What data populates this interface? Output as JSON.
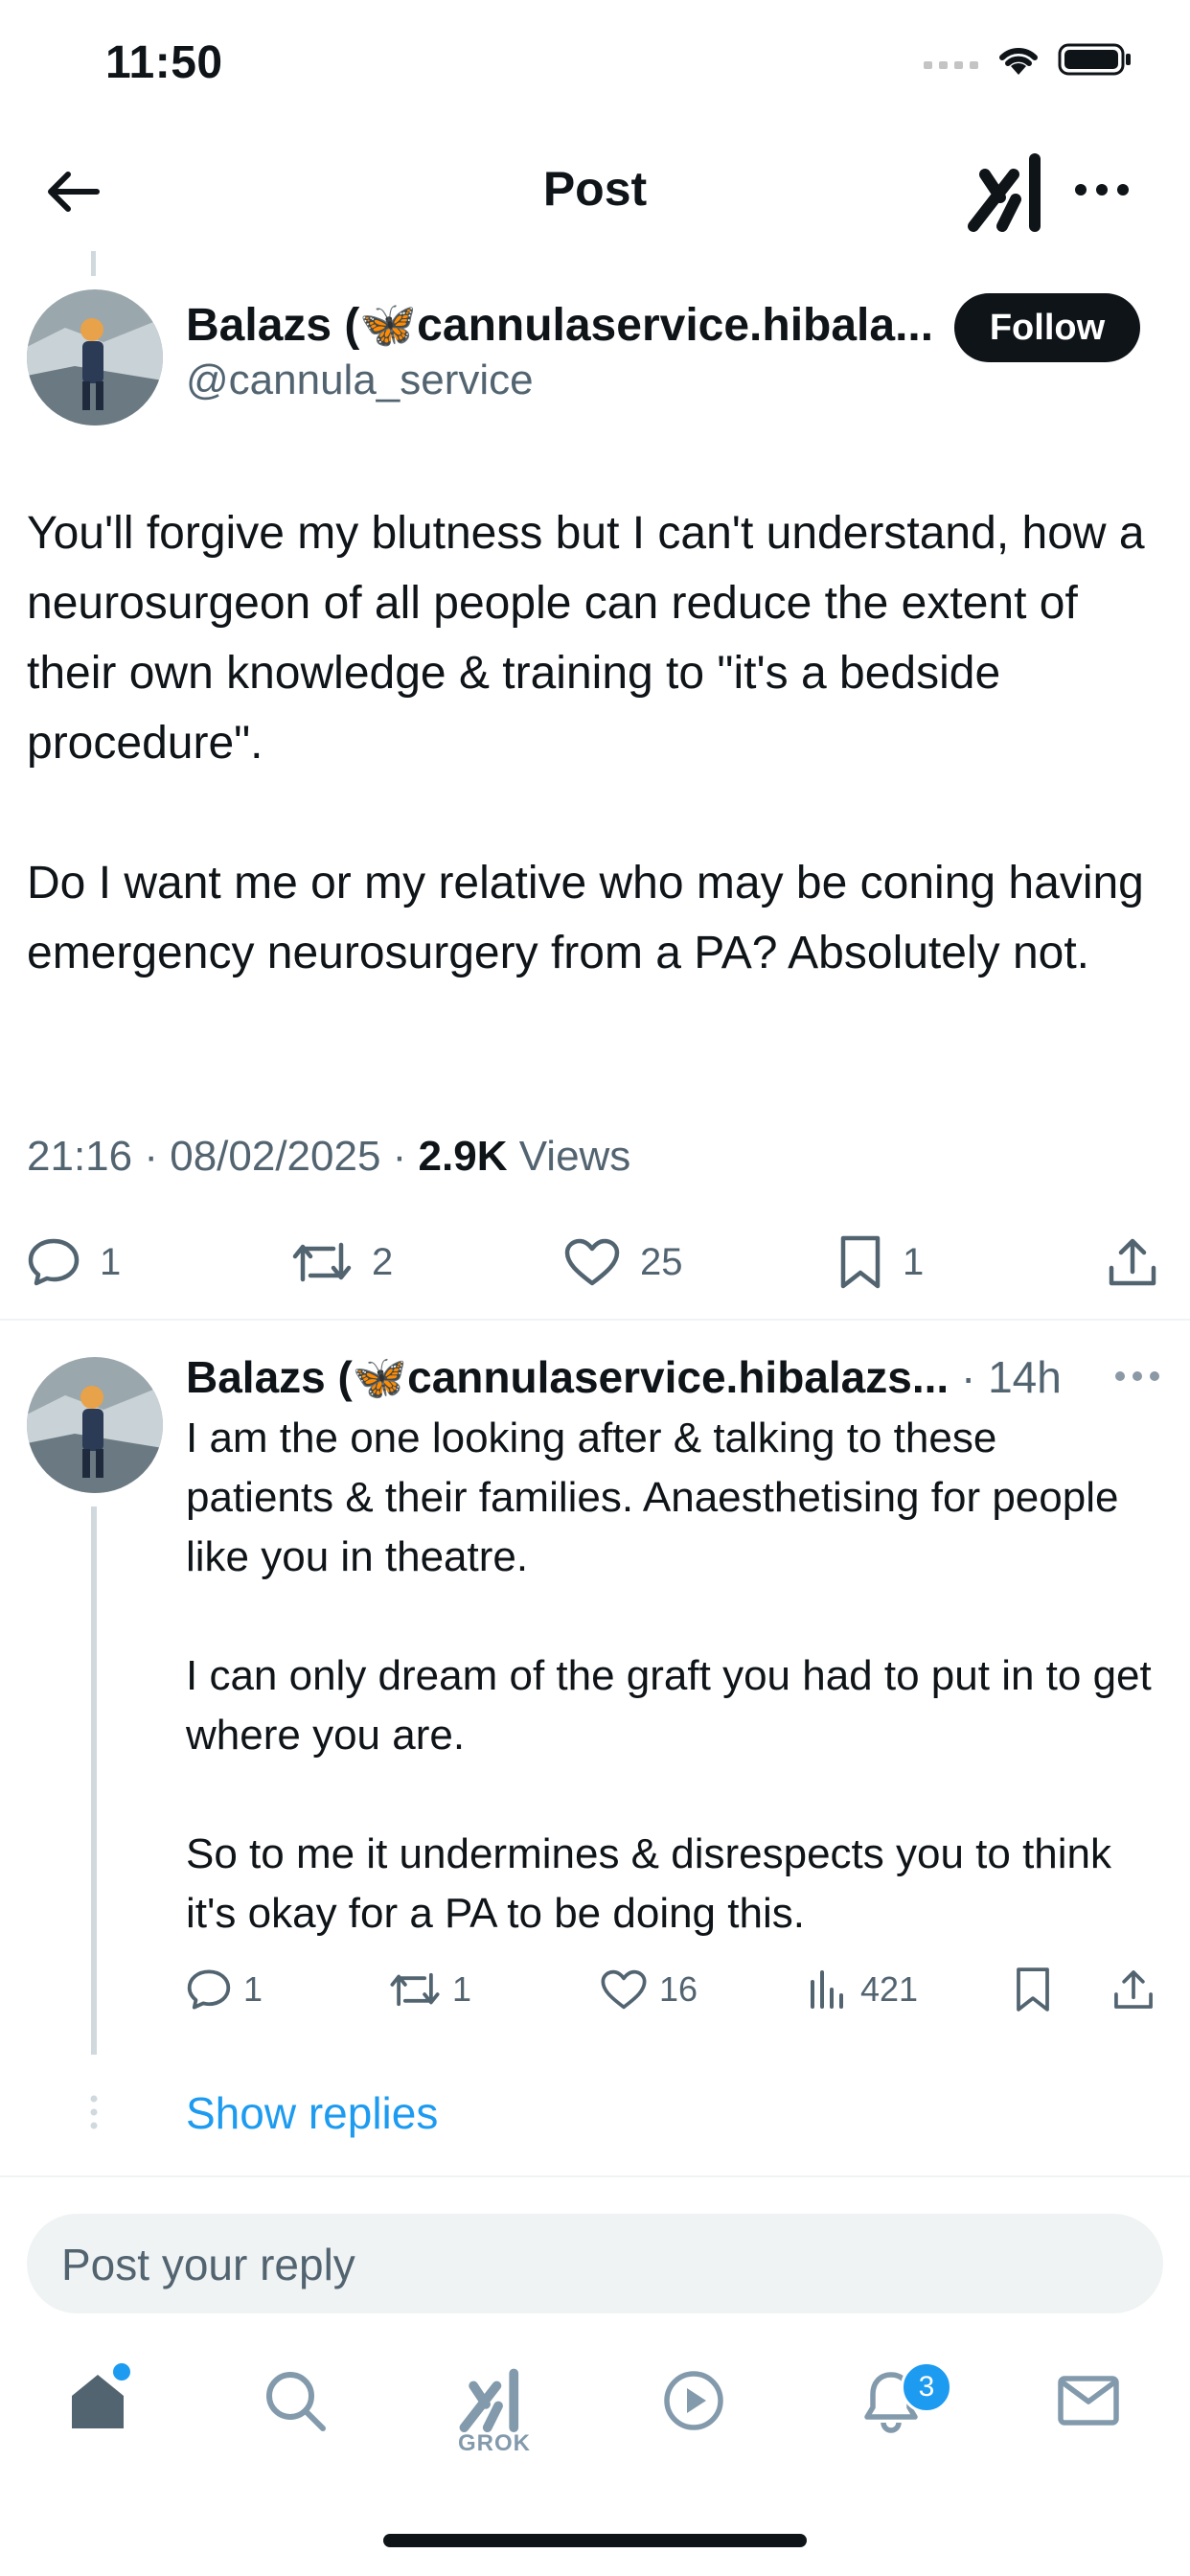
{
  "status_bar": {
    "time": "11:50"
  },
  "header": {
    "title": "Post"
  },
  "post": {
    "author_name": "Balazs (🦋cannulaservice.hibala...",
    "handle": "@cannula_service",
    "follow_label": "Follow",
    "paragraphs": [
      "You'll forgive my blutness but I can't understand, how a neurosurgeon of all people can reduce the extent of their own knowledge & training to \"it's a bedside procedure\".",
      "Do I want me or my relative who may be coning having emergency neurosurgery from a PA? Absolutely not."
    ],
    "time": "21:16",
    "date": "08/02/2025",
    "views_count": "2.9K",
    "views_label": "Views",
    "replies": "1",
    "reposts": "2",
    "likes": "25",
    "bookmarks": "1"
  },
  "reply": {
    "author_name": "Balazs (🦋cannulaservice.hibalazs...",
    "time": "14h",
    "paragraphs": [
      "I am the one looking after & talking to these patients & their families. Anaesthetising for people like you in theatre.",
      "I can only dream of the graft you had to put in to get where you are.",
      "So to me it undermines & disrespects you to think it's okay for a PA to be doing this."
    ],
    "replies": "1",
    "reposts": "1",
    "likes": "16",
    "views": "421"
  },
  "show_replies_label": "Show replies",
  "composer": {
    "placeholder": "Post your reply"
  },
  "tabbar": {
    "grok_label": "GROK",
    "notifications_badge": "3"
  }
}
